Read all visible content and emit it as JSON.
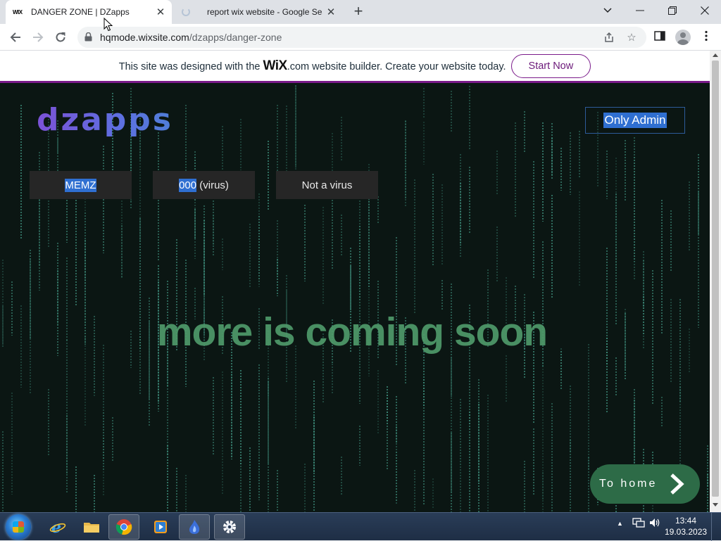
{
  "browser": {
    "tabs": [
      {
        "favicon": "WIX",
        "title": "DANGER ZONE | DZapps",
        "active": true
      },
      {
        "favicon": "loading-spinner-icon",
        "title": "report wix website - Google Sear",
        "active": false
      }
    ],
    "url_host": "hqmode.wixsite.com",
    "url_path": "/dzapps/danger-zone"
  },
  "wix_banner": {
    "text_before": "This site was designed with the ",
    "logo": "WiX",
    "text_after": ".com website builder. Create your website today.",
    "button": "Start Now"
  },
  "site": {
    "logo": "dzapps",
    "admin_button": "Only Admin",
    "nav": [
      {
        "selected": "MEMZ",
        "rest": ""
      },
      {
        "selected": "000",
        "rest": " (virus)"
      },
      {
        "selected": "",
        "rest": "Not a virus"
      }
    ],
    "headline": "more is coming soon",
    "home_button": "To home"
  },
  "taskbar": {
    "time": "13:44",
    "date": "19.03.2023"
  },
  "colors": {
    "banner_accent": "#7a1a8a",
    "page_bg": "#0b1613",
    "rain": "#3f8f7d",
    "headline": "#4f9a6a",
    "home_button": "#2d6b47",
    "selection": "#2f6fd1"
  }
}
